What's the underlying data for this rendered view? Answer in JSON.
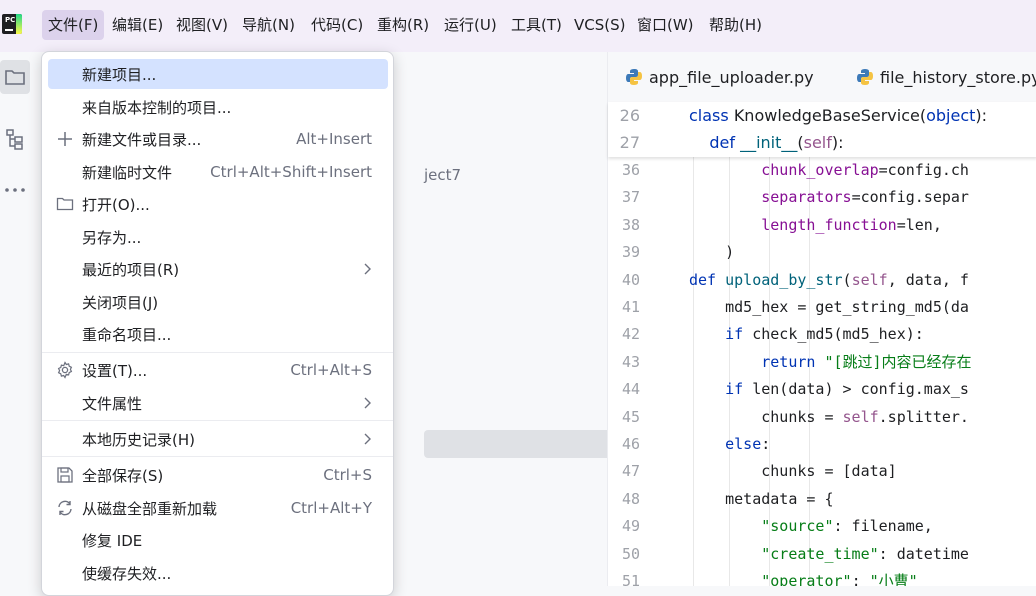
{
  "menubar": {
    "items": [
      {
        "label": "文件(F)",
        "active": true
      },
      {
        "label": "编辑(E)"
      },
      {
        "label": "视图(V)"
      },
      {
        "label": "导航(N)"
      },
      {
        "label": "代码(C)"
      },
      {
        "label": "重构(R)"
      },
      {
        "label": "运行(U)"
      },
      {
        "label": "工具(T)"
      },
      {
        "label": "VCS(S)"
      },
      {
        "label": "窗口(W)"
      },
      {
        "label": "帮助(H)"
      }
    ]
  },
  "logo": {
    "text": "PC"
  },
  "project_panel": {
    "fragment": "ject7"
  },
  "file_menu": {
    "items": [
      {
        "label": "新建项目...",
        "highlighted": true
      },
      {
        "label": "来自版本控制的项目..."
      },
      {
        "label": "新建文件或目录...",
        "shortcut": "Alt+Insert",
        "icon": "plus-icon"
      },
      {
        "label": "新建临时文件",
        "shortcut": "Ctrl+Alt+Shift+Insert"
      },
      {
        "label": "打开(O)...",
        "icon": "folder-icon"
      },
      {
        "label": "另存为..."
      },
      {
        "label": "最近的项目(R)",
        "submenu": true
      },
      {
        "label": "关闭项目(J)"
      },
      {
        "label": "重命名项目..."
      },
      {
        "label": "设置(T)...",
        "shortcut": "Ctrl+Alt+S",
        "icon": "gear-icon"
      },
      {
        "label": "文件属性",
        "submenu": true
      },
      {
        "label": "本地历史记录(H)",
        "submenu": true
      },
      {
        "label": "全部保存(S)",
        "shortcut": "Ctrl+S",
        "icon": "save-icon"
      },
      {
        "label": "从磁盘全部重新加载",
        "shortcut": "Ctrl+Alt+Y",
        "icon": "reload-icon"
      },
      {
        "label": "修复 IDE"
      },
      {
        "label": "使缓存失效..."
      }
    ]
  },
  "editor": {
    "tabs": [
      {
        "label": "app_file_uploader.py"
      },
      {
        "label": "file_history_store.py"
      }
    ],
    "sticky": [
      {
        "n": "26",
        "tokens": [
          [
            "kw",
            "class "
          ],
          [
            "",
            "KnowledgeBaseService("
          ],
          [
            "kw",
            "object"
          ],
          [
            "",
            "):"
          ]
        ]
      },
      {
        "n": "27",
        "tokens": [
          [
            "kw",
            "    def "
          ],
          [
            "fn",
            "__init__"
          ],
          [
            "",
            "("
          ],
          [
            "sf",
            "self"
          ],
          [
            "",
            "):"
          ]
        ]
      }
    ],
    "lines": [
      {
        "n": "36",
        "tokens": [
          [
            "",
            "        "
          ],
          [
            "nm",
            "chunk_overlap"
          ],
          [
            "",
            "=config.ch"
          ]
        ]
      },
      {
        "n": "37",
        "tokens": [
          [
            "",
            "        "
          ],
          [
            "nm",
            "separators"
          ],
          [
            "",
            "=config.separ"
          ]
        ]
      },
      {
        "n": "38",
        "tokens": [
          [
            "",
            "        "
          ],
          [
            "nm",
            "length_function"
          ],
          [
            "",
            "=len,"
          ]
        ]
      },
      {
        "n": "39",
        "tokens": [
          [
            "",
            "    )"
          ]
        ]
      },
      {
        "n": "40",
        "tokens": [
          [
            "kw",
            "def "
          ],
          [
            "fn",
            "upload_by_str"
          ],
          [
            "",
            "("
          ],
          [
            "sf",
            "self"
          ],
          [
            "",
            ", data, f"
          ]
        ]
      },
      {
        "n": "41",
        "tokens": [
          [
            "",
            "    md5_hex = get_string_md5(da"
          ]
        ]
      },
      {
        "n": "42",
        "tokens": [
          [
            "kw",
            "    if "
          ],
          [
            "",
            "check_md5(md5_hex):"
          ]
        ]
      },
      {
        "n": "43",
        "tokens": [
          [
            "kw",
            "        return "
          ],
          [
            "st",
            "\"[跳过]内容已经存在"
          ]
        ]
      },
      {
        "n": "44",
        "tokens": [
          [
            "kw",
            "    if "
          ],
          [
            "",
            "len(data) > config.max_s"
          ]
        ]
      },
      {
        "n": "45",
        "tokens": [
          [
            "",
            "        chunks = "
          ],
          [
            "sf",
            "self"
          ],
          [
            "",
            ".splitter."
          ]
        ]
      },
      {
        "n": "46",
        "tokens": [
          [
            "kw",
            "    else"
          ],
          [
            "",
            ":"
          ]
        ]
      },
      {
        "n": "47",
        "tokens": [
          [
            "",
            "        chunks = [data]"
          ]
        ]
      },
      {
        "n": "48",
        "tokens": [
          [
            "",
            "    metadata = {"
          ]
        ]
      },
      {
        "n": "49",
        "tokens": [
          [
            "st",
            "        \"source\""
          ],
          [
            "",
            ": filename,"
          ]
        ]
      },
      {
        "n": "50",
        "tokens": [
          [
            "st",
            "        \"create_time\""
          ],
          [
            "",
            ": datetime"
          ]
        ]
      },
      {
        "n": "51",
        "tokens": [
          [
            "st",
            "        \"operator\""
          ],
          [
            "",
            ": "
          ],
          [
            "st",
            "\"小曹\""
          ]
        ]
      }
    ]
  },
  "colors": {
    "menubar_bg": "#f3eef9",
    "menu_active": "#dcd2ec",
    "item_highlight": "#d4e2ff",
    "keyword": "#0033b3",
    "string": "#067d17",
    "function": "#00627a",
    "self": "#94558d"
  }
}
